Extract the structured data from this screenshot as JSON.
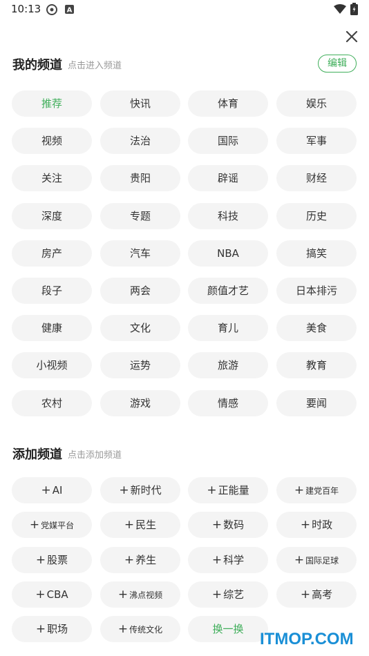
{
  "status_bar": {
    "time": "10:13"
  },
  "my_channels": {
    "title": "我的频道",
    "hint": "点击进入频道",
    "edit_label": "编辑",
    "items": [
      {
        "label": "推荐",
        "active": true
      },
      {
        "label": "快讯"
      },
      {
        "label": "体育"
      },
      {
        "label": "娱乐"
      },
      {
        "label": "视频"
      },
      {
        "label": "法治"
      },
      {
        "label": "国际"
      },
      {
        "label": "军事"
      },
      {
        "label": "关注"
      },
      {
        "label": "贵阳"
      },
      {
        "label": "辟谣"
      },
      {
        "label": "财经"
      },
      {
        "label": "深度"
      },
      {
        "label": "专题"
      },
      {
        "label": "科技"
      },
      {
        "label": "历史"
      },
      {
        "label": "房产"
      },
      {
        "label": "汽车"
      },
      {
        "label": "NBA"
      },
      {
        "label": "搞笑"
      },
      {
        "label": "段子"
      },
      {
        "label": "两会"
      },
      {
        "label": "颜值才艺"
      },
      {
        "label": "日本排污"
      },
      {
        "label": "健康"
      },
      {
        "label": "文化"
      },
      {
        "label": "育儿"
      },
      {
        "label": "美食"
      },
      {
        "label": "小视频"
      },
      {
        "label": "运势"
      },
      {
        "label": "旅游"
      },
      {
        "label": "教育"
      },
      {
        "label": "农村"
      },
      {
        "label": "游戏"
      },
      {
        "label": "情感"
      },
      {
        "label": "要闻"
      }
    ]
  },
  "add_channels": {
    "title": "添加频道",
    "hint": "点击添加频道",
    "plus_symbol": "+",
    "items": [
      {
        "label": "AI"
      },
      {
        "label": "新时代"
      },
      {
        "label": "正能量"
      },
      {
        "label": "建党百年",
        "small": true
      },
      {
        "label": "党媒平台",
        "small": true
      },
      {
        "label": "民生"
      },
      {
        "label": "数码"
      },
      {
        "label": "时政"
      },
      {
        "label": "股票"
      },
      {
        "label": "养生"
      },
      {
        "label": "科学"
      },
      {
        "label": "国际足球",
        "small": true
      },
      {
        "label": "CBA"
      },
      {
        "label": "沸点视频",
        "small": true
      },
      {
        "label": "综艺"
      },
      {
        "label": "高考"
      },
      {
        "label": "职场"
      },
      {
        "label": "传统文化",
        "small": true
      }
    ],
    "swap_label": "换一换"
  },
  "watermark": "ITMOP.COM",
  "colors": {
    "accent": "#3fae5a",
    "chip_bg": "#f4f4f4",
    "hint": "#999999",
    "watermark": "#1a8fd6"
  },
  "icons": [
    "settings-icon",
    "a-icon",
    "wifi-icon",
    "battery-icon",
    "close-icon"
  ]
}
